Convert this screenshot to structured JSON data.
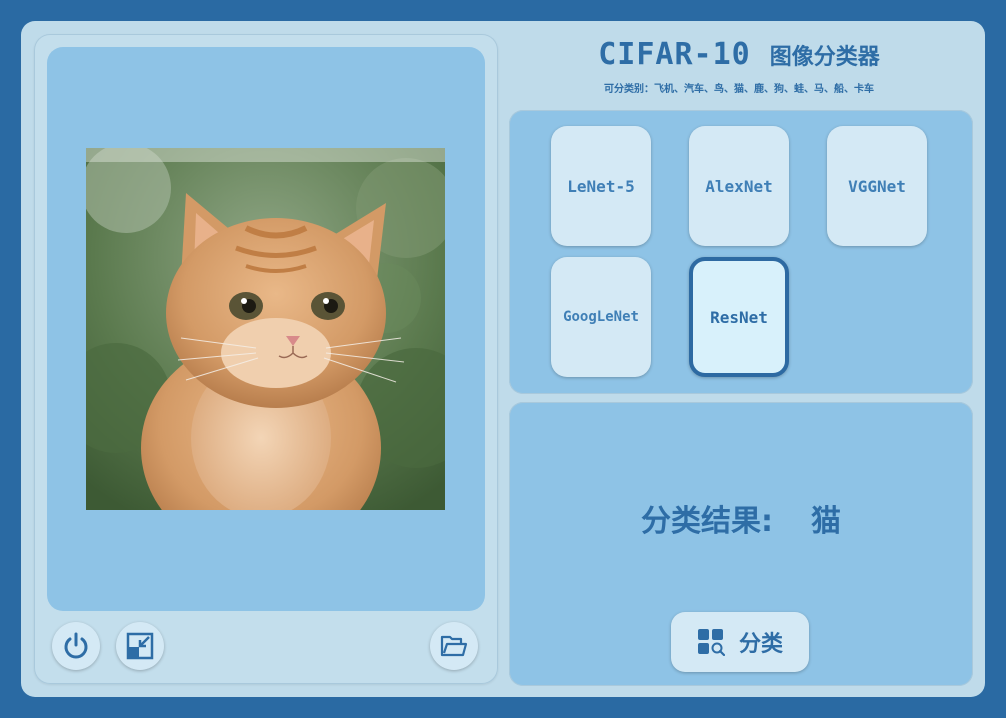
{
  "app": {
    "title_main": "CIFAR-10",
    "title_cn": "图像分类器",
    "subtitle": "可分类别：飞机、汽车、鸟、猫、鹿、狗、蛙、马、船、卡车"
  },
  "image_view": {
    "subject": "orange tabby kitten"
  },
  "bottom_bar": {
    "power_icon": "power-icon",
    "minimize_icon": "minimize-window-icon",
    "open_icon": "folder-open-icon"
  },
  "models": [
    {
      "label": "LeNet-5",
      "selected": false
    },
    {
      "label": "AlexNet",
      "selected": false
    },
    {
      "label": "VGGNet",
      "selected": false
    },
    {
      "label": "GoogLeNet",
      "selected": false
    },
    {
      "label": "ResNet",
      "selected": true
    }
  ],
  "result": {
    "label": "分类结果:",
    "value": "猫"
  },
  "classify_button": {
    "label": "分类",
    "icon": "grid-search-icon"
  },
  "colors": {
    "outer_bg": "#2a6aa3",
    "window_bg": "#bfdbea",
    "panel_bg": "#8ec3e6",
    "button_bg": "#d4e9f5",
    "accent": "#2e6da6"
  }
}
